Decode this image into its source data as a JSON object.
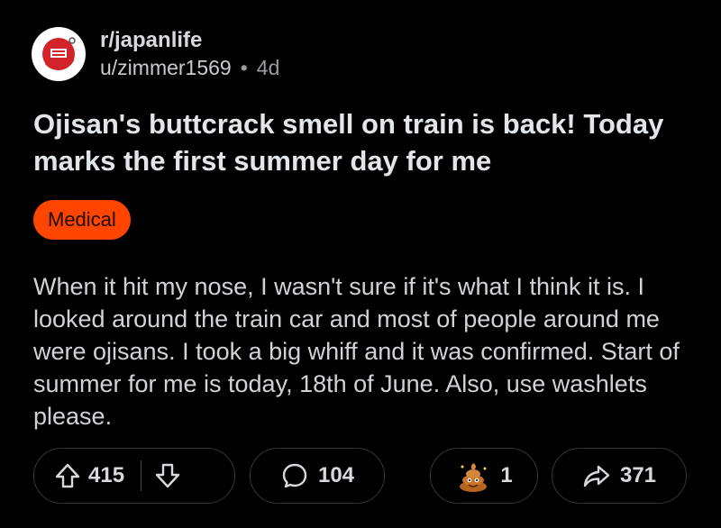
{
  "post": {
    "subreddit": "r/japanlife",
    "username": "u/zimmer1569",
    "separator": "•",
    "age": "4d",
    "title": "Ojisan's buttcrack smell on train is back! Today marks the first summer day for me",
    "flair": "Medical",
    "body": "When it hit my nose, I wasn't sure if it's what I think it is. I looked around the train car and most of people around me were ojisans. I took a big whiff and it was confirmed. Start of summer for me is today, 18th of June. Also, use washlets please."
  },
  "actions": {
    "upvotes": "415",
    "comments": "104",
    "awards": "1",
    "shares": "371"
  },
  "icons": {
    "avatar": "japanlife-logo",
    "upvote": "arrow-up-icon",
    "downvote": "arrow-down-icon",
    "comment": "speech-bubble-icon",
    "award": "poop-award-icon",
    "share": "share-arrow-icon"
  },
  "colors": {
    "background": "#000000",
    "flair": "#ff4500",
    "text": "#d7dadc"
  }
}
